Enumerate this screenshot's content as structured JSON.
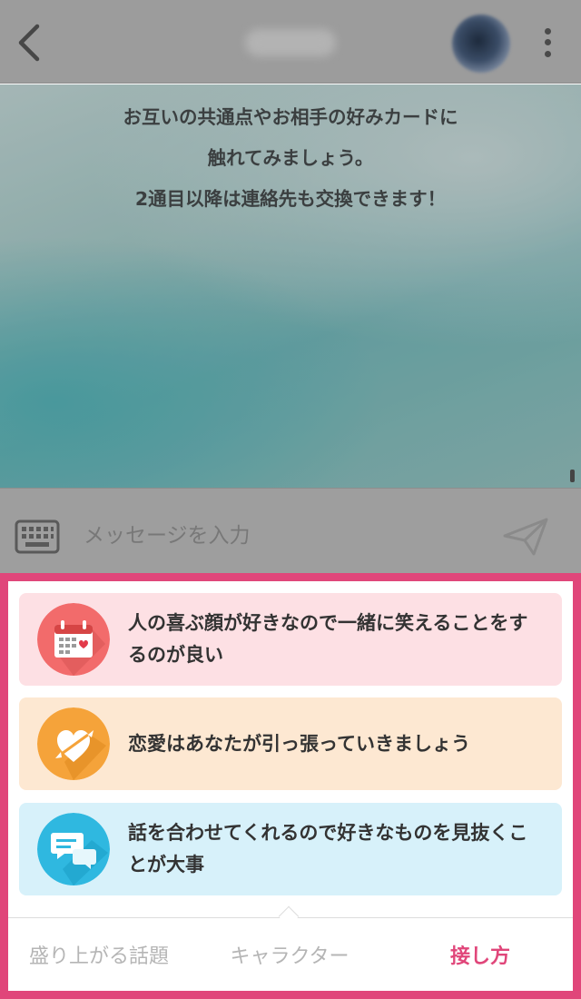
{
  "colors": {
    "accent": "#e0467a",
    "overlay_gray": "#9c9c9c",
    "card_pink": "#fde0e4",
    "card_orange": "#fde8d2",
    "card_blue": "#d7f1fa",
    "icon_red": "#f26b6b",
    "icon_orange": "#f5a33a",
    "icon_blue": "#2fb8e0"
  },
  "header": {
    "back_icon": "chevron-left-icon",
    "more_icon": "vertical-ellipsis-icon"
  },
  "chat": {
    "notice_lines": [
      "お互いの共通点やお相手の好みカードに",
      "触れてみましょう。",
      "2通目以降は連絡先も交換できます！"
    ]
  },
  "composer": {
    "keyboard_icon": "keyboard-icon",
    "placeholder": "メッセージを入力",
    "send_icon": "send-icon"
  },
  "sheet": {
    "cards": [
      {
        "icon": "calendar-heart-icon",
        "text": "人の喜ぶ顔が好きなので一緒に笑えることをするのが良い"
      },
      {
        "icon": "heart-arrow-icon",
        "text": "恋愛はあなたが引っ張っていきましょう"
      },
      {
        "icon": "chat-bubbles-icon",
        "text": "話を合わせてくれるので好きなものを見抜くことが大事"
      }
    ],
    "tabs": [
      {
        "label": "盛り上がる話題",
        "active": false
      },
      {
        "label": "キャラクター",
        "active": false
      },
      {
        "label": "接し方",
        "active": true
      }
    ]
  }
}
